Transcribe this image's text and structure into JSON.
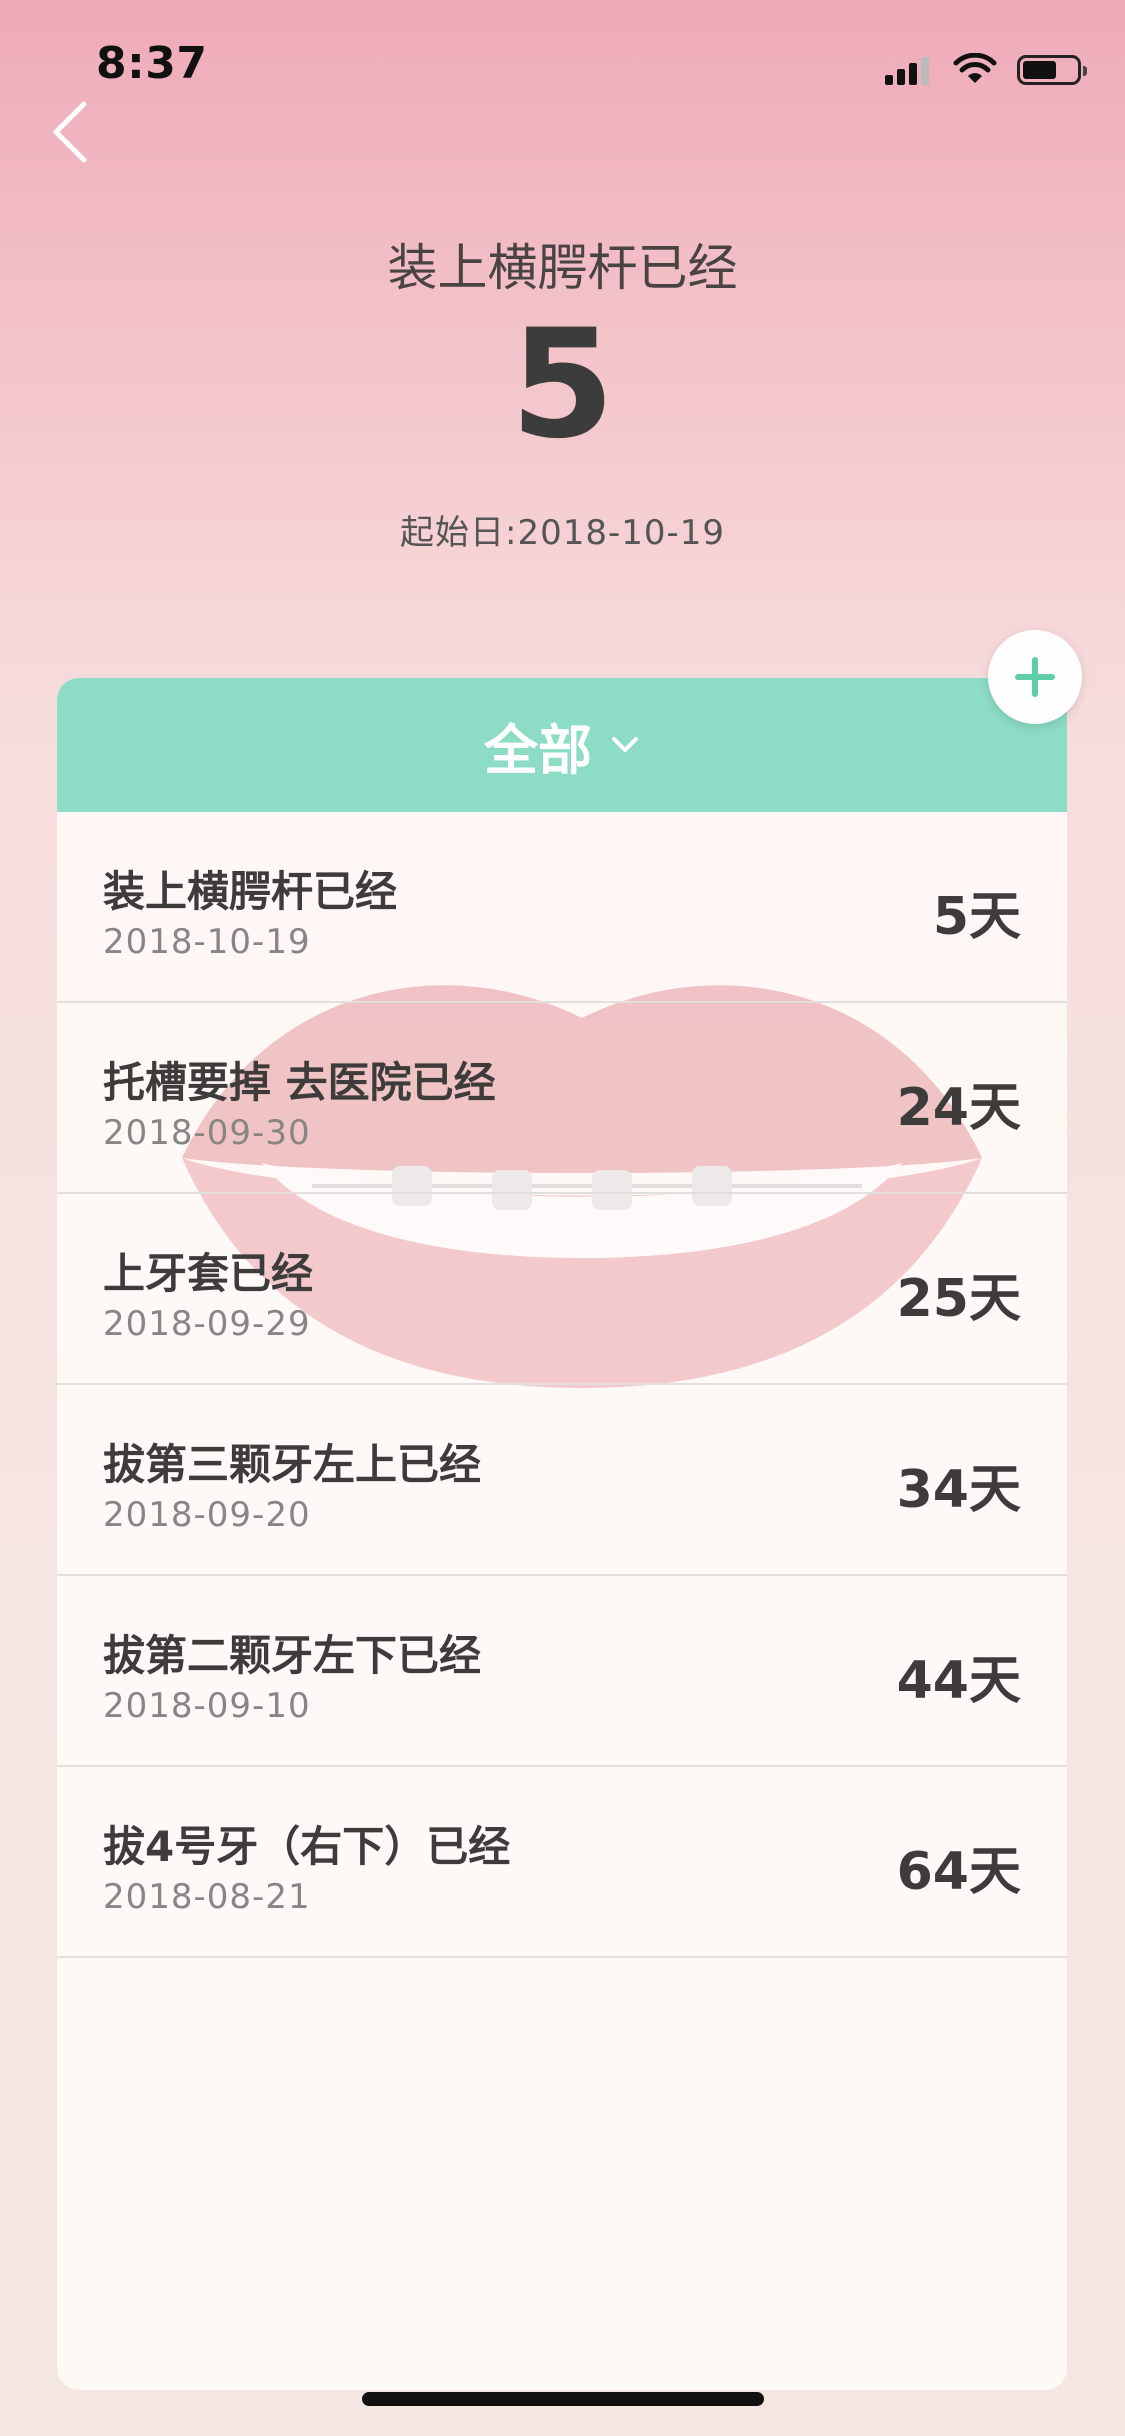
{
  "status_bar": {
    "time": "8:37"
  },
  "header": {
    "title": "装上横腭杆已经",
    "count": "5",
    "start_label": "起始日:",
    "start_date": "2018-10-19"
  },
  "filter": {
    "label": "全部"
  },
  "events": [
    {
      "title": "装上横腭杆已经",
      "date": "2018-10-19",
      "days": "5天"
    },
    {
      "title": "托槽要掉 去医院已经",
      "date": "2018-09-30",
      "days": "24天"
    },
    {
      "title": "上牙套已经",
      "date": "2018-09-29",
      "days": "25天"
    },
    {
      "title": "拔第三颗牙左上已经",
      "date": "2018-09-20",
      "days": "34天"
    },
    {
      "title": "拔第二颗牙左下已经",
      "date": "2018-09-10",
      "days": "44天"
    },
    {
      "title": "拔4号牙（右下）已经",
      "date": "2018-08-21",
      "days": "64天"
    }
  ],
  "colors": {
    "accent": "#8ddcc5",
    "add_plus": "#5ccfa8"
  },
  "icons": {
    "back": "chevron-left-icon",
    "add": "plus-icon",
    "filter": "chevron-down-icon"
  }
}
